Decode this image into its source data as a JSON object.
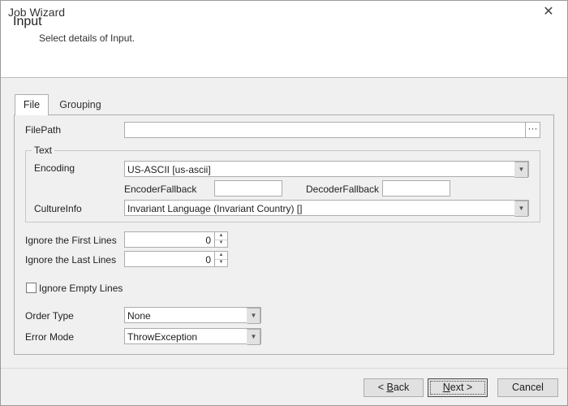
{
  "window": {
    "title": "Job Wizard"
  },
  "header": {
    "title": "Input",
    "subtitle": "Select details of Input."
  },
  "tabs": [
    {
      "label": "File"
    },
    {
      "label": "Grouping"
    }
  ],
  "form": {
    "filepath": {
      "label": "FilePath",
      "value": "",
      "browse_label": "···"
    },
    "text_group": {
      "label": "Text",
      "encoding": {
        "label": "Encoding",
        "value": "US-ASCII [us-ascii]"
      },
      "encoder_fallback": {
        "label": "EncoderFallback",
        "value": ""
      },
      "decoder_fallback": {
        "label": "DecoderFallback",
        "value": ""
      },
      "culture_info": {
        "label": "CultureInfo",
        "value": "Invariant Language (Invariant Country) []"
      }
    },
    "ignore_first_lines": {
      "label": "Ignore the First Lines",
      "value": "0"
    },
    "ignore_last_lines": {
      "label": "Ignore the Last Lines",
      "value": "0"
    },
    "ignore_empty_lines": {
      "label": "Ignore Empty Lines",
      "checked": false
    },
    "order_type": {
      "label": "Order Type",
      "value": "None"
    },
    "error_mode": {
      "label": "Error Mode",
      "value": "ThrowException"
    }
  },
  "footer": {
    "back": {
      "prefix": "< ",
      "accel": "B",
      "rest": "ack"
    },
    "next": {
      "accel": "N",
      "rest": "ext >"
    },
    "cancel": {
      "label": "Cancel"
    }
  }
}
